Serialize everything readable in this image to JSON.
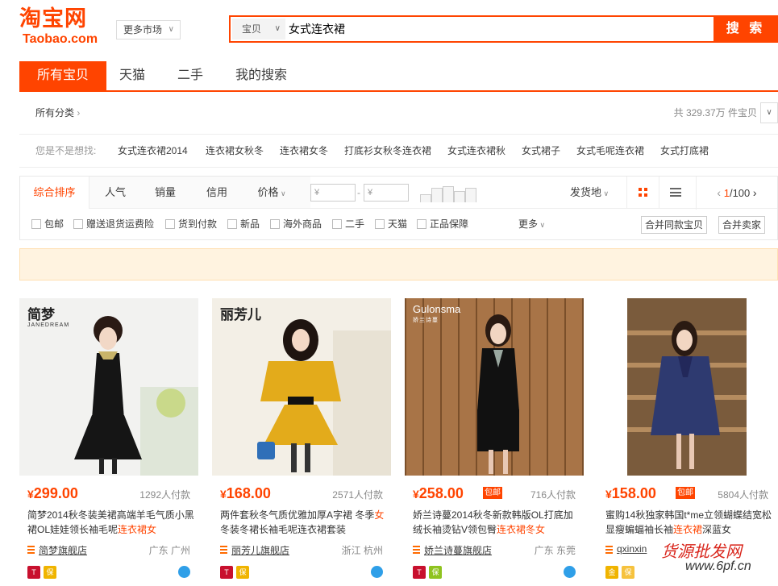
{
  "header": {
    "logo_cn": "淘宝网",
    "logo_en": "Taobao.com",
    "market_label": "更多市场",
    "search_type": "宝贝",
    "search_query": "女式连衣裙",
    "search_button": "搜 索"
  },
  "tabs": [
    {
      "label": "所有宝贝",
      "active": true
    },
    {
      "label": "天猫",
      "active": false
    },
    {
      "label": "二手",
      "active": false
    },
    {
      "label": "我的搜索",
      "active": false
    }
  ],
  "category": {
    "all_label": "所有分类",
    "count_text": "共 329.37万 件宝贝"
  },
  "suggestions": {
    "label": "您是不是想找:",
    "items": [
      "女式连衣裙2014",
      "连衣裙女秋冬",
      "连衣裙女冬",
      "打底衫女秋冬连衣裙",
      "女式连衣裙秋",
      "女式裙子",
      "女式毛呢连衣裙",
      "女式打底裙"
    ]
  },
  "sort": {
    "items": [
      {
        "label": "综合排序",
        "active": true
      },
      {
        "label": "人气",
        "active": false
      },
      {
        "label": "销量",
        "active": false
      },
      {
        "label": "信用",
        "active": false
      },
      {
        "label": "价格",
        "active": false
      }
    ],
    "price_from": "¥",
    "price_to": "¥",
    "price_dash": "-",
    "ship_label": "发货地",
    "page_current": "1",
    "page_total": "/100"
  },
  "filters": {
    "checkboxes": [
      "包邮",
      "赠送退货运费险",
      "货到付款",
      "新品",
      "海外商品",
      "二手",
      "天猫",
      "正品保障"
    ],
    "more_label": "更多",
    "merge_same": "合并同款宝贝",
    "merge_seller": "合并卖家"
  },
  "products": [
    {
      "brand": "简梦",
      "brand_sub": "JANEDREAM",
      "currency": "¥",
      "price": "299.00",
      "baoyou": "",
      "sold": "1292人付款",
      "title_pre": "简梦2014秋冬装美裙高端羊毛气质小黑裙OL娃娃领长袖毛呢",
      "title_hl": "连衣裙女",
      "title_post": "",
      "shop": "简梦旗舰店",
      "location": "广东 广州",
      "accent": "#222222"
    },
    {
      "brand": "丽芳儿",
      "brand_sub": "",
      "currency": "¥",
      "price": "168.00",
      "baoyou": "",
      "sold": "2571人付款",
      "title_pre": "两件套秋冬气质优雅加厚A字裙 冬季",
      "title_hl": "女",
      "title_post": "冬装冬裙长袖毛呢连衣裙套装",
      "shop": "丽芳儿旗舰店",
      "location": "浙江 杭州",
      "accent": "#e0a81c"
    },
    {
      "brand": "Gulonsma",
      "brand_sub": "娇兰诗蔓",
      "currency": "¥",
      "price": "258.00",
      "baoyou": "包邮",
      "sold": "716人付款",
      "title_pre": "娇兰诗蔓2014秋冬新款韩版OL打底加绒长袖烫钻V领包臀",
      "title_hl": "连衣裙冬女",
      "title_post": "",
      "shop": "娇兰诗蔓旗舰店",
      "location": "广东 东莞",
      "accent": "#111111"
    },
    {
      "brand": "",
      "brand_sub": "",
      "currency": "¥",
      "price": "158.00",
      "baoyou": "包邮",
      "sold": "5804人付款",
      "title_pre": "蜜购14秋独家韩国t*me立领蝴蝶结宽松显瘦蝙蝠袖长袖",
      "title_hl": "连衣裙",
      "title_post": "深蓝女",
      "shop": "qxinxin",
      "location": "",
      "accent": "#2e3a70"
    }
  ],
  "watermark": {
    "text": "货源批发网",
    "sub": "www.6pf.cn"
  }
}
